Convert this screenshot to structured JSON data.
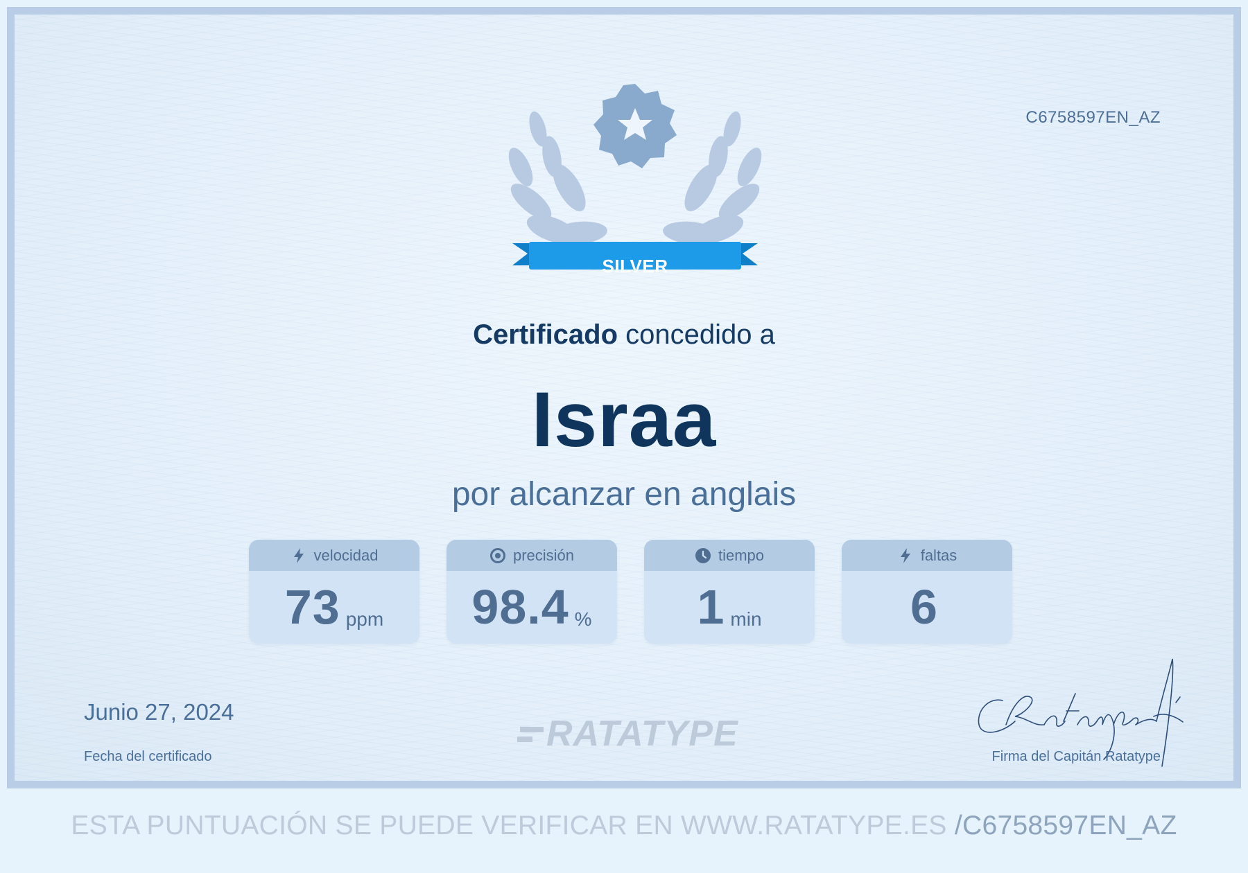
{
  "certificate": {
    "id": "C6758597EN_AZ",
    "badge": "SILVER",
    "heading_bold": "Certificado",
    "heading_rest": " concedido a",
    "name": "Israa",
    "subline": "por alcanzar en anglais",
    "stats": [
      {
        "label": "velocidad",
        "icon": "lightning-icon",
        "value": "73",
        "unit": "ppm"
      },
      {
        "label": "precisión",
        "icon": "target-icon",
        "value": "98.4",
        "unit": "%"
      },
      {
        "label": "tiempo",
        "icon": "clock-icon",
        "value": "1",
        "unit": "min"
      },
      {
        "label": "faltas",
        "icon": "lightning-icon",
        "value": "6",
        "unit": ""
      }
    ],
    "date": "Junio 27, 2024",
    "date_label": "Fecha del certificado",
    "logo": "RATATYPE",
    "signature_text": "CRatatype-fé",
    "signature_label": "Firma del Capitán Ratatype"
  },
  "footer": {
    "text": "ESTA PUNTUACIÓN SE PUEDE VERIFICAR EN WWW.RATATYPE.ES",
    "code": "/C6758597EN_AZ"
  },
  "colors": {
    "page_bg": "#e6f2fc",
    "border": "#b9cee6",
    "badge_blue": "#1e9be8",
    "title_navy": "#0f355d",
    "text_blue": "#4a6f98"
  }
}
